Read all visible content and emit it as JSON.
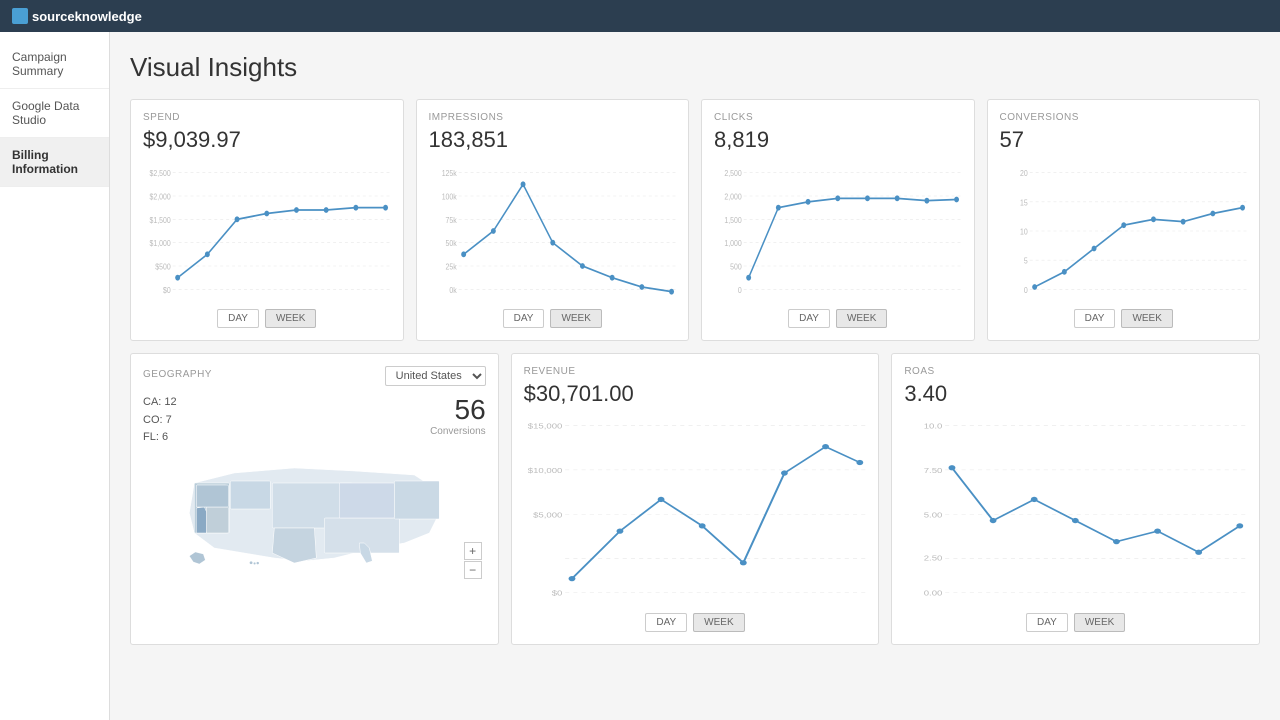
{
  "app": {
    "logo_text": "sourceknowledge",
    "logo_icon": "sk"
  },
  "sidebar": {
    "items": [
      {
        "label": "Campaign Summary",
        "active": false
      },
      {
        "label": "Google Data Studio",
        "active": false
      },
      {
        "label": "Billing Information",
        "active": true
      }
    ]
  },
  "page": {
    "title": "Visual Insights"
  },
  "cards": {
    "spend": {
      "label": "SPEND",
      "value": "$9,039.97",
      "y_labels": [
        "$2,500.00",
        "$2,000.00",
        "$1,500.00",
        "$1,000.00",
        "$500.00",
        "$0.00"
      ]
    },
    "impressions": {
      "label": "IMPRESSIONS",
      "value": "183,851",
      "y_labels": [
        "125k",
        "100k",
        "75k",
        "50k",
        "25k",
        "0k"
      ]
    },
    "clicks": {
      "label": "CLICKS",
      "value": "8,819",
      "y_labels": [
        "2,500",
        "2,000",
        "1,500",
        "1,000",
        "500",
        "0"
      ]
    },
    "conversions": {
      "label": "CONVERSIONS",
      "value": "57",
      "y_labels": [
        "20",
        "15",
        "10",
        "5",
        "0"
      ]
    },
    "geography": {
      "label": "GEOGRAPHY",
      "select_value": "United States",
      "stats": [
        {
          "state": "CA:",
          "value": "12"
        },
        {
          "state": "CO:",
          "value": "7"
        },
        {
          "state": "FL:",
          "value": "6"
        }
      ],
      "conversions_count": "56",
      "conversions_label": "Conversions"
    },
    "revenue": {
      "label": "REVENUE",
      "value": "$30,701.00",
      "y_labels": [
        "$15,000.00",
        "$10,000.00",
        "$5,000.00",
        "$0.00"
      ]
    },
    "roas": {
      "label": "ROAS",
      "value": "3.40",
      "y_labels": [
        "10.0",
        "7.50",
        "5.00",
        "2.50",
        "0.00"
      ]
    }
  },
  "buttons": {
    "day": "DAY",
    "week": "WEEK"
  }
}
